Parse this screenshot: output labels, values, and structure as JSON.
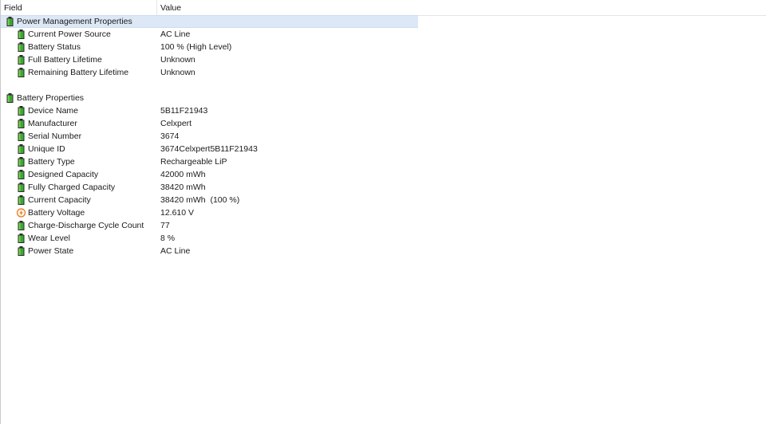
{
  "header": {
    "field_label": "Field",
    "value_label": "Value"
  },
  "groups": [
    {
      "title": "Power Management Properties",
      "icon": "battery-icon",
      "items": [
        {
          "field": "Current Power Source",
          "value": "AC Line",
          "icon": "battery-icon"
        },
        {
          "field": "Battery Status",
          "value": "100 % (High Level)",
          "icon": "battery-icon"
        },
        {
          "field": "Full Battery Lifetime",
          "value": "Unknown",
          "icon": "battery-icon"
        },
        {
          "field": "Remaining Battery Lifetime",
          "value": "Unknown",
          "icon": "battery-icon"
        }
      ]
    },
    {
      "title": "Battery Properties",
      "icon": "battery-icon",
      "items": [
        {
          "field": "Device Name",
          "value": "5B11F21943",
          "icon": "battery-icon"
        },
        {
          "field": "Manufacturer",
          "value": "Celxpert",
          "icon": "battery-icon"
        },
        {
          "field": "Serial Number",
          "value": "3674",
          "icon": "battery-icon"
        },
        {
          "field": "Unique ID",
          "value": "3674Celxpert5B11F21943",
          "icon": "battery-icon"
        },
        {
          "field": "Battery Type",
          "value": "Rechargeable LiP",
          "icon": "battery-icon"
        },
        {
          "field": "Designed Capacity",
          "value": "42000 mWh",
          "icon": "battery-icon"
        },
        {
          "field": "Fully Charged Capacity",
          "value": "38420 mWh",
          "icon": "battery-icon"
        },
        {
          "field": "Current Capacity",
          "value": "38420 mWh  (100 %)",
          "icon": "battery-icon"
        },
        {
          "field": "Battery Voltage",
          "value": "12.610 V",
          "icon": "voltage-icon"
        },
        {
          "field": "Charge-Discharge Cycle Count",
          "value": "77",
          "icon": "battery-icon"
        },
        {
          "field": "Wear Level",
          "value": "8 %",
          "icon": "battery-icon"
        },
        {
          "field": "Power State",
          "value": "AC Line",
          "icon": "battery-icon"
        }
      ]
    }
  ],
  "colors": {
    "selection": "#dde8f6",
    "battery_green": "#3aa935",
    "voltage_orange": "#e8741c"
  }
}
